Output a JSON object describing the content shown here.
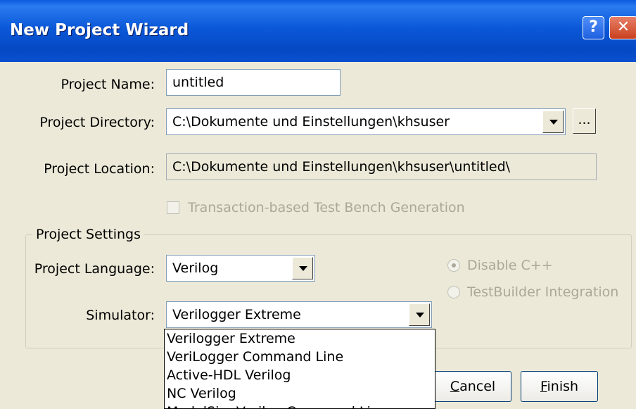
{
  "window": {
    "title": "New Project Wizard",
    "help_label": "?",
    "close_label": "✕"
  },
  "form": {
    "project_name_label": "Project Name:",
    "project_name_value": "untitled",
    "project_directory_label": "Project Directory:",
    "project_directory_value": "C:\\Dokumente und Einstellungen\\khsuser",
    "browse_label": "...",
    "project_location_label": "Project Location:",
    "project_location_value": "C:\\Dokumente und Einstellungen\\khsuser\\untitled\\",
    "transaction_checkbox_label": "Transaction-based Test Bench Generation"
  },
  "settings": {
    "group_title": "Project Settings",
    "language_label": "Project Language:",
    "language_value": "Verilog",
    "simulator_label": "Simulator:",
    "simulator_value": "Verilogger Extreme",
    "radio_disable_cpp": "Disable C++",
    "radio_testbuilder": "TestBuilder Integration"
  },
  "simulator_options": [
    "Verilogger Extreme",
    "VeriLogger Command Line",
    "Active-HDL Verilog",
    "NC Verilog",
    "ModelSim Verilog Command Line"
  ],
  "buttons": {
    "cancel_u": "C",
    "cancel_rest": "ancel",
    "finish_u": "F",
    "finish_rest": "inish"
  }
}
